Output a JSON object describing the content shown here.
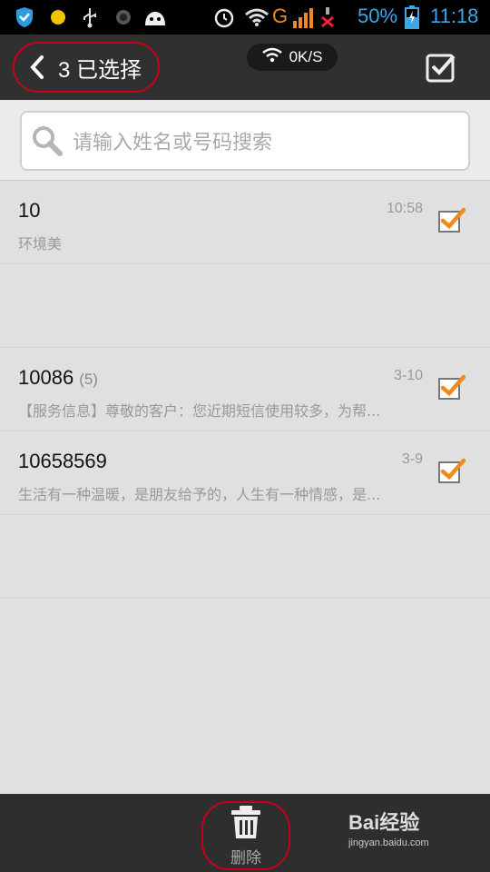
{
  "status_bar": {
    "battery_text": "50%",
    "time": "11:18",
    "network_type": "G",
    "icons": [
      "shield-icon",
      "sun-icon",
      "usb-icon",
      "camera-icon",
      "android-icon",
      "alarm-icon",
      "wifi-icon",
      "signal-icon",
      "battery-icon"
    ]
  },
  "header": {
    "title": "3 已选择",
    "speed": "0K/S"
  },
  "search": {
    "placeholder": "请输入姓名或号码搜索"
  },
  "messages": [
    {
      "name": "10",
      "count": "",
      "time": "10:58",
      "preview": "环境美",
      "checked": true
    },
    {
      "name": "10086",
      "count": "(5)",
      "time": "3-10",
      "preview": "【服务信息】尊敬的客户：您近期短信使用较多，为帮...",
      "checked": true
    },
    {
      "name": "10658569",
      "count": "",
      "time": "3-9",
      "preview": "生活有一种温暖，是朋友给予的，人生有一种情感，是...",
      "checked": true
    }
  ],
  "bottom": {
    "delete_label": "删除"
  },
  "watermark": {
    "brand": "Bai经验",
    "url": "jingyan.baidu.com"
  },
  "colors": {
    "accent_blue": "#3ea6e6",
    "check_orange": "#f08a1c",
    "highlight_red": "#c8001a",
    "bar_dark": "#303030"
  }
}
